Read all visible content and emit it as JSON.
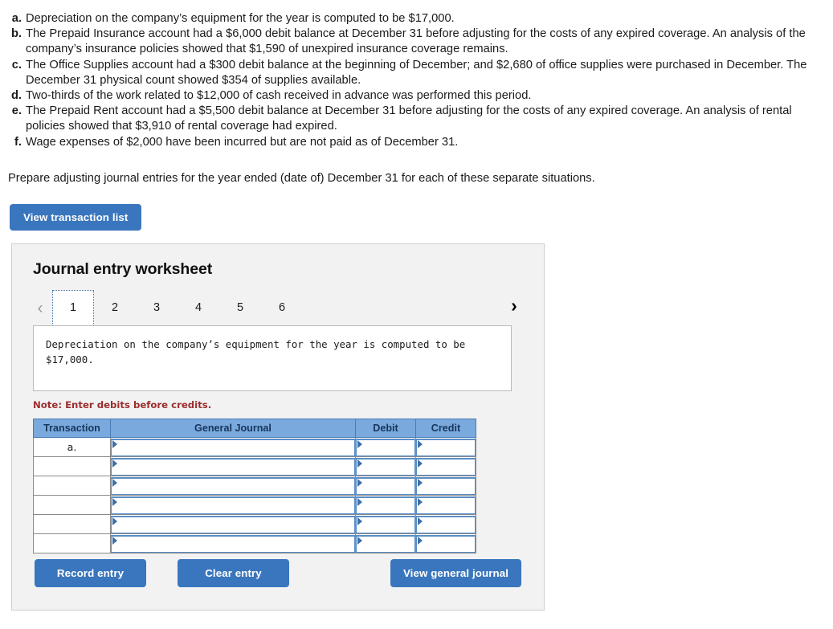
{
  "situations": [
    {
      "letter": "a.",
      "text": "Depreciation on the company’s equipment for the year is computed to be $17,000."
    },
    {
      "letter": "b.",
      "text": "The Prepaid Insurance account had a $6,000 debit balance at December 31 before adjusting for the costs of any expired coverage. An analysis of the company’s insurance policies showed that $1,590 of unexpired insurance coverage remains."
    },
    {
      "letter": "c.",
      "text": "The Office Supplies account had a $300 debit balance at the beginning of December; and $2,680 of office supplies were purchased in December. The December 31 physical count showed $354 of supplies available."
    },
    {
      "letter": "d.",
      "text": "Two-thirds of the work related to $12,000 of cash received in advance was performed this period."
    },
    {
      "letter": "e.",
      "text": "The Prepaid Rent account had a $5,500 debit balance at December 31 before adjusting for the costs of any expired coverage. An analysis of rental policies showed that $3,910 of rental coverage had expired."
    },
    {
      "letter": "f.",
      "text": "Wage expenses of $2,000 have been incurred but are not paid as of December 31."
    }
  ],
  "instruction": "Prepare adjusting journal entries for the year ended (date of) December 31 for each of these separate situations.",
  "view_transaction_list_label": "View transaction list",
  "worksheet": {
    "title": "Journal entry worksheet",
    "nav": {
      "prev_icon": "chevron-left-icon",
      "prev_glyph": "‹",
      "next_icon": "chevron-right-icon",
      "next_glyph": "›"
    },
    "tabs": [
      "1",
      "2",
      "3",
      "4",
      "5",
      "6"
    ],
    "active_tab": "1",
    "description": "Depreciation on the company’s equipment for the year is computed to be $17,000.",
    "note": "Note: Enter debits before credits.",
    "table": {
      "headers": [
        "Transaction",
        "General Journal",
        "Debit",
        "Credit"
      ],
      "rows": [
        {
          "transaction": "a.",
          "general_journal": "",
          "debit": "",
          "credit": ""
        },
        {
          "transaction": "",
          "general_journal": "",
          "debit": "",
          "credit": ""
        },
        {
          "transaction": "",
          "general_journal": "",
          "debit": "",
          "credit": ""
        },
        {
          "transaction": "",
          "general_journal": "",
          "debit": "",
          "credit": ""
        },
        {
          "transaction": "",
          "general_journal": "",
          "debit": "",
          "credit": ""
        },
        {
          "transaction": "",
          "general_journal": "",
          "debit": "",
          "credit": ""
        }
      ]
    },
    "buttons": {
      "record": "Record entry",
      "clear": "Clear entry",
      "view_journal": "View general journal"
    }
  },
  "colors": {
    "button_blue": "#3a76bd",
    "table_header_blue": "#7aa9dd",
    "table_header_text": "#17365d",
    "note_red": "#9c2d2d",
    "panel_bg": "#f2f2f2",
    "panel_border": "#cfcfcf"
  }
}
